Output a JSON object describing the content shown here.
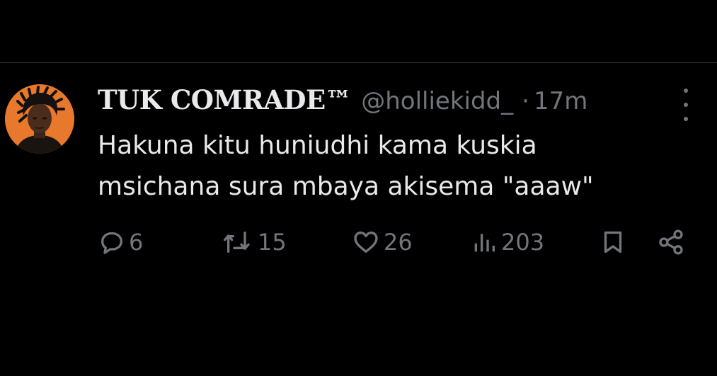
{
  "tweet": {
    "display_name": "TUK COMRADE™",
    "handle": "@holliekidd_",
    "separator": "·",
    "time": "17m",
    "text_lines": [
      "Hakuna kitu huniudhi kama kuskia",
      "msichana sura mbaya akisema \"aaaw\""
    ],
    "avatar_bg": "#e8782b"
  },
  "actions": {
    "replies": "6",
    "retweets": "15",
    "likes": "26",
    "views": "203",
    "icons": [
      "reply-icon",
      "retweet-icon",
      "like-icon",
      "views-icon",
      "bookmark-icon",
      "share-icon"
    ]
  },
  "colors": {
    "background": "#000000",
    "text": "#e7e9ea",
    "muted": "#71767b",
    "divider": "#2f3336"
  }
}
